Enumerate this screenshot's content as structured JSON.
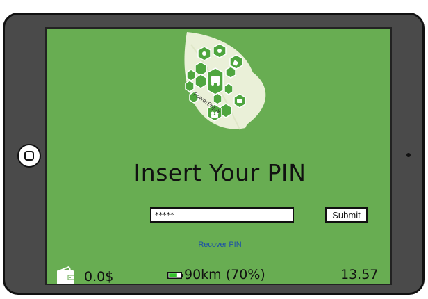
{
  "app": {
    "logo_text": "PowerEnJoy"
  },
  "pin": {
    "title": "Insert Your PIN",
    "value": "*****",
    "submit_label": "Submit",
    "recover_label": "Recover PIN"
  },
  "status": {
    "balance": "0.0$",
    "range": "90km (70%)",
    "battery_percent": 70,
    "clock": "13.57"
  },
  "icons": {
    "home": "home-button-icon",
    "camera": "camera-icon",
    "wallet": "wallet-icon",
    "battery": "battery-icon",
    "logo": "leaf-logo-icon"
  },
  "colors": {
    "screen_bg": "#68ad52",
    "frame": "#4a4a4a",
    "leaf": "#eaf0d8",
    "hex_green": "#4fa63f",
    "link": "#1c4fa8",
    "battery_fill": "#35c22c"
  }
}
